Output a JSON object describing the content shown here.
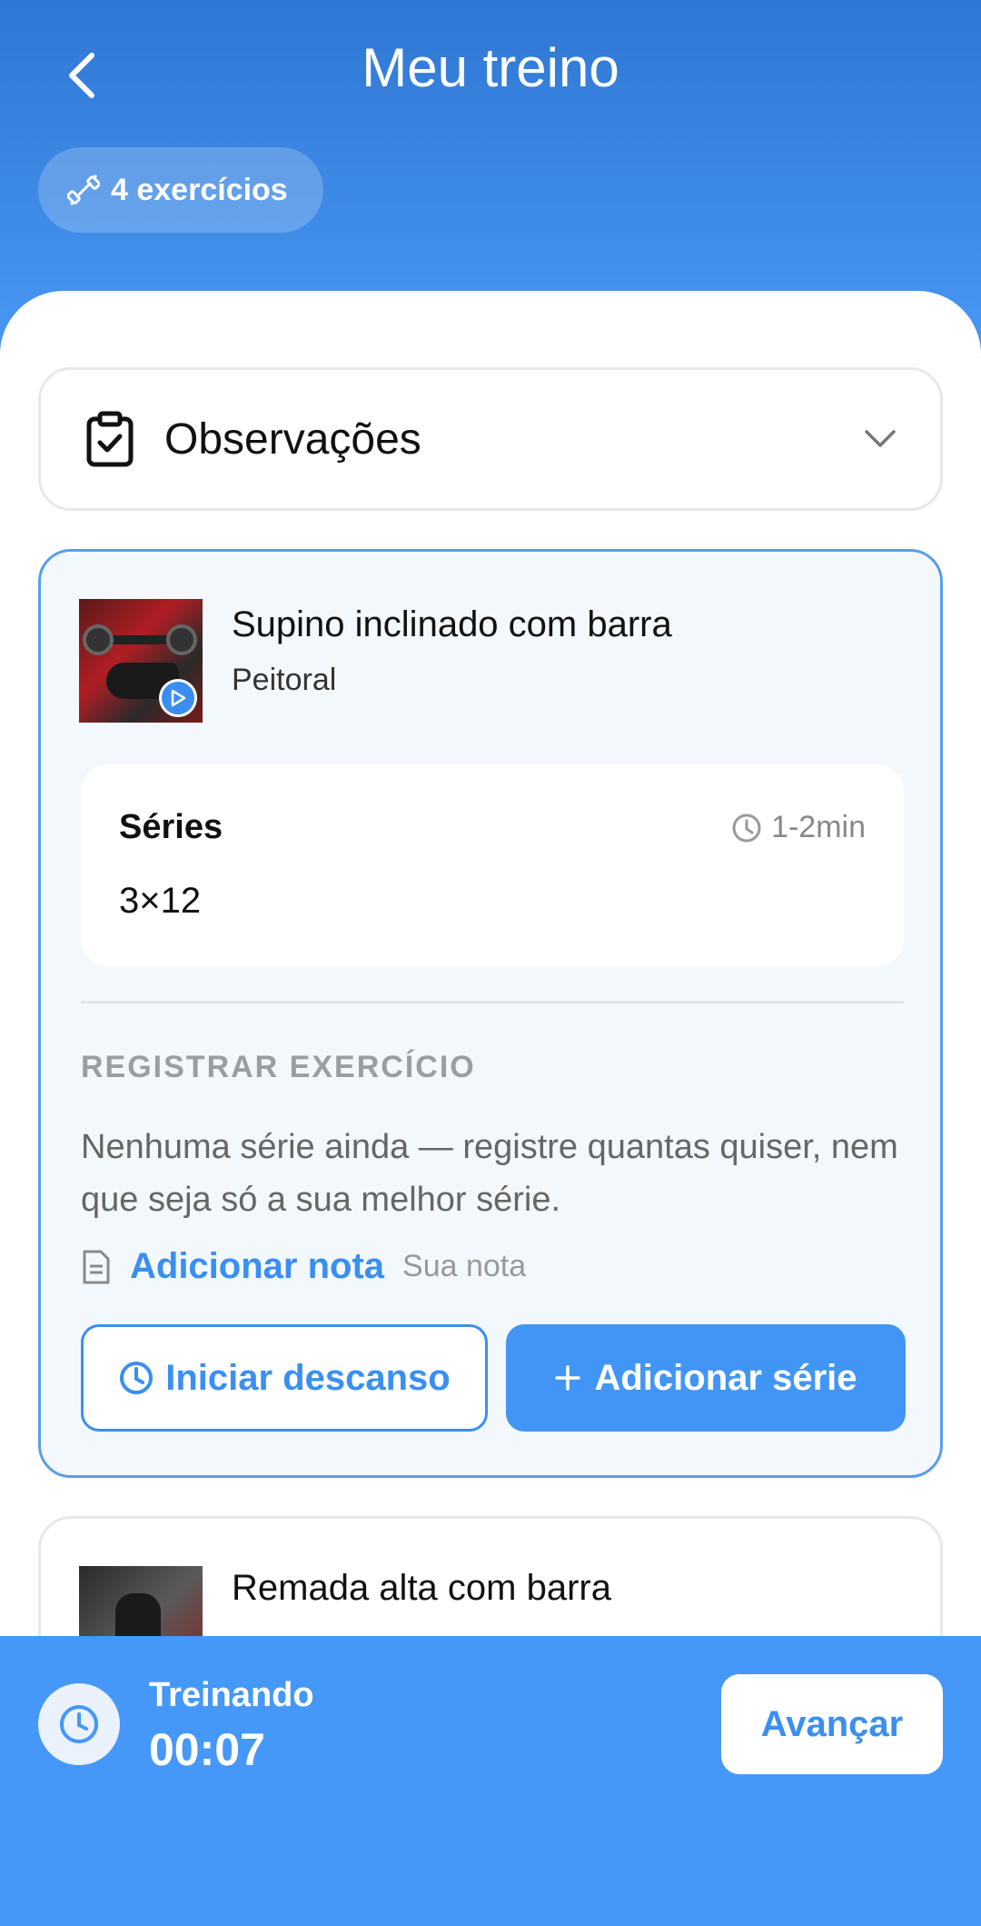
{
  "header": {
    "title": "Meu treino",
    "back_icon": "chevron-left-icon",
    "exercise_count_label": "4 exercícios",
    "count_icon": "dumbbell-icon"
  },
  "observations": {
    "label": "Observações",
    "icon": "clipboard-check-icon",
    "expand_icon": "chevron-down-icon"
  },
  "exercises": [
    {
      "name": "Supino inclinado com barra",
      "muscle": "Peitoral",
      "series_label": "Séries",
      "series_value": "3×12",
      "rest_time": "1-2min",
      "register_heading": "REGISTRAR EXERCÍCIO",
      "hint": "Nenhuma série ainda — registre quantas quiser, nem que seja só a sua melhor série.",
      "add_note_label": "Adicionar nota",
      "note_placeholder": "Sua nota",
      "start_rest_label": "Iniciar descanso",
      "add_series_label": "Adicionar série"
    },
    {
      "name": "Remada alta com barra"
    }
  ],
  "footer": {
    "status_label": "Treinando",
    "elapsed": "00:07",
    "advance_label": "Avançar"
  },
  "colors": {
    "primary": "#4196f5",
    "header_top": "#2f78d4",
    "header_bottom": "#4a9af5",
    "card_border_active": "#5a9ee8",
    "card_bg_active": "#f3f8fd"
  }
}
